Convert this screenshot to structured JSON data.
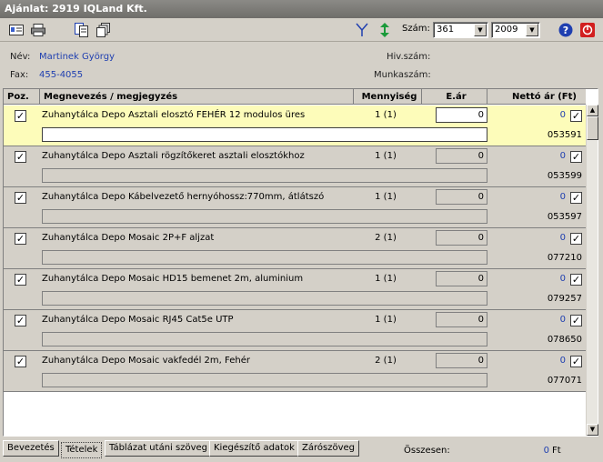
{
  "window": {
    "title": "Ajánlat: 2919 IQLand Kft."
  },
  "toolbar": {
    "icons": [
      "card-icon",
      "print-icon",
      "copy-doc-icon",
      "stack-docs-icon",
      "filter-icon",
      "sort-arrows-icon",
      "help-icon",
      "close-icon"
    ],
    "szam_label": "Szám:",
    "szam_value": "361",
    "year_value": "2009"
  },
  "header": {
    "nev_label": "Név:",
    "nev_value": "Martinek György",
    "fax_label": "Fax:",
    "fax_value": "455-4055",
    "hivszam_label": "Hiv.szám:",
    "munkaszam_label": "Munkaszám:"
  },
  "columns": {
    "poz": "Poz.",
    "name": "Megnevezés / megjegyzés",
    "qty": "Mennyiség",
    "unit_price": "E.ár",
    "net_price": "Nettó ár (Ft)"
  },
  "rows": [
    {
      "checked": true,
      "name": "Zuhanytálca Depo Asztali elosztó FEHÉR 12 modulos üres",
      "qty": "1 (1)",
      "price": "0",
      "net": "0",
      "code": "053591",
      "selected": true
    },
    {
      "checked": true,
      "name": "Zuhanytálca Depo Asztali rögzítőkeret asztali elosztókhoz",
      "qty": "1 (1)",
      "price": "0",
      "net": "0",
      "code": "053599",
      "selected": false
    },
    {
      "checked": true,
      "name": "Zuhanytálca Depo Kábelvezető hernyóhossz:770mm, átlátszó",
      "qty": "1 (1)",
      "price": "0",
      "net": "0",
      "code": "053597",
      "selected": false
    },
    {
      "checked": true,
      "name": "Zuhanytálca Depo Mosaic 2P+F aljzat",
      "qty": "2 (1)",
      "price": "0",
      "net": "0",
      "code": "077210",
      "selected": false
    },
    {
      "checked": true,
      "name": "Zuhanytálca Depo Mosaic HD15 bemenet 2m, aluminium",
      "qty": "1 (1)",
      "price": "0",
      "net": "0",
      "code": "079257",
      "selected": false
    },
    {
      "checked": true,
      "name": "Zuhanytálca Depo Mosaic RJ45 Cat5e UTP",
      "qty": "1 (1)",
      "price": "0",
      "net": "0",
      "code": "078650",
      "selected": false
    },
    {
      "checked": true,
      "name": "Zuhanytálca Depo Mosaic vakfedél 2m, Fehér",
      "qty": "2 (1)",
      "price": "0",
      "net": "0",
      "code": "077071",
      "selected": false
    }
  ],
  "tabs": [
    "Bevezetés",
    "Tételek",
    "Táblázat utáni szöveg",
    "Kiegészítő adatok",
    "Zárószöveg"
  ],
  "active_tab": "Tételek",
  "summary": {
    "label": "Összesen:",
    "value": "0",
    "unit": "Ft"
  },
  "colors": {
    "selected_row": "#fdfcba",
    "value_blue": "#1f3fb0"
  }
}
